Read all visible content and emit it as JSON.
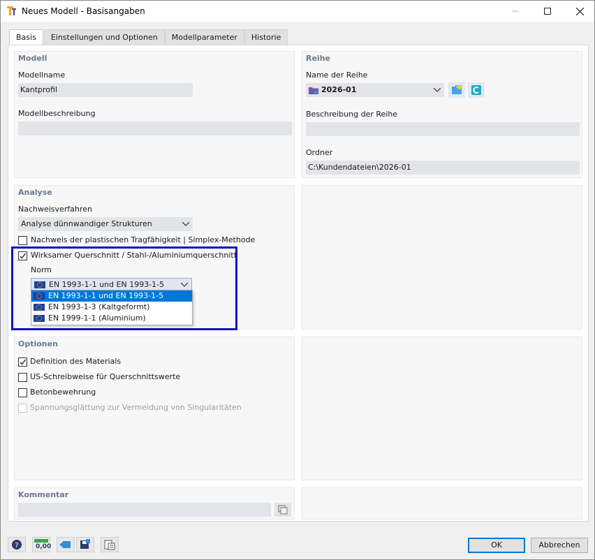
{
  "window": {
    "title": "Neues Modell - Basisangaben"
  },
  "tabs": [
    {
      "label": "Basis"
    },
    {
      "label": "Einstellungen und Optionen"
    },
    {
      "label": "Modellparameter"
    },
    {
      "label": "Historie"
    }
  ],
  "modell": {
    "title": "Modell",
    "name_label": "Modellname",
    "name_value": "Kantprofil",
    "desc_label": "Modellbeschreibung",
    "desc_value": ""
  },
  "reihe": {
    "title": "Reihe",
    "name_label": "Name der Reihe",
    "name_value": "2026-01",
    "desc_label": "Beschreibung der Reihe",
    "desc_value": "",
    "folder_label": "Ordner",
    "folder_value": "C:\\Kundendateien\\2026-01"
  },
  "analyse": {
    "title": "Analyse",
    "method_label": "Nachweisverfahren",
    "method_value": "Analyse dünnwandiger Strukturen",
    "plastic_label": "Nachweis der plastischen Tragfähigkeit | Simplex-Methode",
    "plastic_checked": false,
    "effective_label": "Wirksamer Querschnitt / Stahl-/Aluminiumquerschnitt",
    "effective_checked": true,
    "norm_label": "Norm",
    "norm_value": "EN 1993-1-1 und EN 1993-1-5",
    "norm_options": [
      "EN 1993-1-1 und EN 1993-1-5",
      "EN 1993-1-3 (Kaltgeformt)",
      "EN 1999-1-1 (Aluminium)"
    ]
  },
  "optionen": {
    "title": "Optionen",
    "items": [
      {
        "label": "Definition des Materials",
        "checked": true
      },
      {
        "label": "US-Schreibweise für Querschnittswerte",
        "checked": false
      },
      {
        "label": "Betonbewehrung",
        "checked": false
      },
      {
        "label": "Spannungsglättung zur Vermeidung von Singularitäten",
        "checked": false
      }
    ]
  },
  "kommentar": {
    "title": "Kommentar",
    "value": ""
  },
  "footer": {
    "ok_label": "OK",
    "cancel_label": "Abbrechen",
    "units_icon_text": "0,00"
  },
  "colors": {
    "accent": "#0078d7",
    "highlight_border": "#1010c8",
    "section_title": "#6a7a8e",
    "field_bg": "#e3e4e8"
  }
}
